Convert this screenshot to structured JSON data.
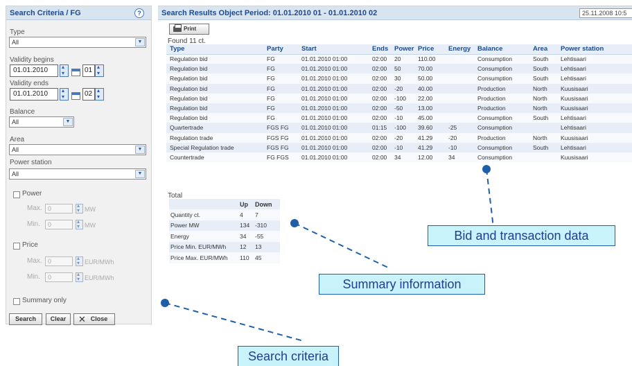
{
  "search_panel": {
    "title": "Search Criteria / FG",
    "help_label": "?",
    "type_label": "Type",
    "type_value": "All",
    "validity_begins_label": "Validity begins",
    "validity_begins_date": "01.01.2010",
    "validity_begins_period": "01",
    "validity_ends_label": "Validity ends",
    "validity_ends_date": "01.01.2010",
    "validity_ends_period": "02",
    "balance_label": "Balance",
    "balance_value": "All",
    "area_label": "Area",
    "area_value": "All",
    "power_station_label": "Power station",
    "power_station_value": "All",
    "power_label": "Power",
    "power_max_label": "Max.",
    "power_max_value": "0",
    "power_min_label": "Min.",
    "power_min_value": "0",
    "power_unit": "MW",
    "price_label": "Price",
    "price_max_label": "Max.",
    "price_max_value": "0",
    "price_min_label": "Min.",
    "price_min_value": "0",
    "price_unit": "EUR/MWh",
    "summary_only_label": "Summary only",
    "search_button": "Search",
    "clear_button": "Clear",
    "close_button": "Close"
  },
  "results_panel": {
    "title": "Search Results   Object Period: 01.01.2010 01 - 01.01.2010 02",
    "date": "25.11.2008 10:5",
    "print_button": "Print",
    "found": "Found 11 ct.",
    "columns": [
      "Type",
      "Party",
      "Start",
      "Ends",
      "Power",
      "Price",
      "Energy",
      "Balance",
      "Area",
      "Power station"
    ],
    "rows": [
      [
        "Regulation bid",
        "FG",
        "01.01.2010 01:00",
        "02:00",
        "20",
        "110.00",
        "",
        "Consumption",
        "South",
        "Lehtisaari"
      ],
      [
        "Regulation bid",
        "FG",
        "01.01.2010 01:00",
        "02:00",
        "50",
        "70.00",
        "",
        "Consumption",
        "South",
        "Lehtisaari"
      ],
      [
        "Regulation bid",
        "FG",
        "01.01.2010 01:00",
        "02:00",
        "30",
        "50.00",
        "",
        "Consumption",
        "South",
        "Lehtisaari"
      ],
      [
        "Regulation bid",
        "FG",
        "01.01.2010 01:00",
        "02:00",
        "-20",
        "40.00",
        "",
        "Production",
        "North",
        "Kuusisaari"
      ],
      [
        "Regulation bid",
        "FG",
        "01.01.2010 01:00",
        "02:00",
        "-100",
        "22.00",
        "",
        "Production",
        "North",
        "Kuusisaari"
      ],
      [
        "Regulation bid",
        "FG",
        "01.01.2010 01:00",
        "02:00",
        "-50",
        "13.00",
        "",
        "Production",
        "North",
        "Kuusisaari"
      ],
      [
        "Regulation bid",
        "FG",
        "01.01.2010 01:00",
        "02:00",
        "-10",
        "45.00",
        "",
        "Consumption",
        "South",
        "Lehtisaari"
      ],
      [
        "Quartertrade",
        "FGS FG",
        "01.01.2010 01:00",
        "01:15",
        "-100",
        "39.60",
        "-25",
        "Consumption",
        "",
        "Lehtisaari"
      ],
      [
        "Regulation trade",
        "FGS FG",
        "01.01.2010 01:00",
        "02:00",
        "-20",
        "41.29",
        "-20",
        "Production",
        "North",
        "Kuusisaari"
      ],
      [
        "Special Regulation trade",
        "FGS FG",
        "01.01.2010 01:00",
        "02:00",
        "-10",
        "41.29",
        "-10",
        "Consumption",
        "South",
        "Lehtisaari"
      ],
      [
        "Countertrade",
        "FG FGS",
        "01.01.2010 01:00",
        "02:00",
        "34",
        "12.00",
        "34",
        "Consumption",
        "",
        "Kuusisaari"
      ]
    ],
    "total_label": "Total",
    "summary_columns": [
      "",
      "Up",
      "Down"
    ],
    "summary_rows": [
      [
        "Quantity ct.",
        "4",
        "7"
      ],
      [
        "Power MW",
        "134",
        "-310"
      ],
      [
        "Energy",
        "34",
        "-55"
      ],
      [
        "Price Min. EUR/MWh",
        "12",
        "13"
      ],
      [
        "Price Max. EUR/MWh",
        "110",
        "45"
      ]
    ]
  },
  "callouts": {
    "bid_data": "Bid and transaction data",
    "summary_info": "Summary information",
    "search_criteria": "Search criteria"
  },
  "colors": {
    "header_blue": "#1d4a8c",
    "callout_fill": "#c9f3fb",
    "callout_border": "#1f5fa8"
  }
}
